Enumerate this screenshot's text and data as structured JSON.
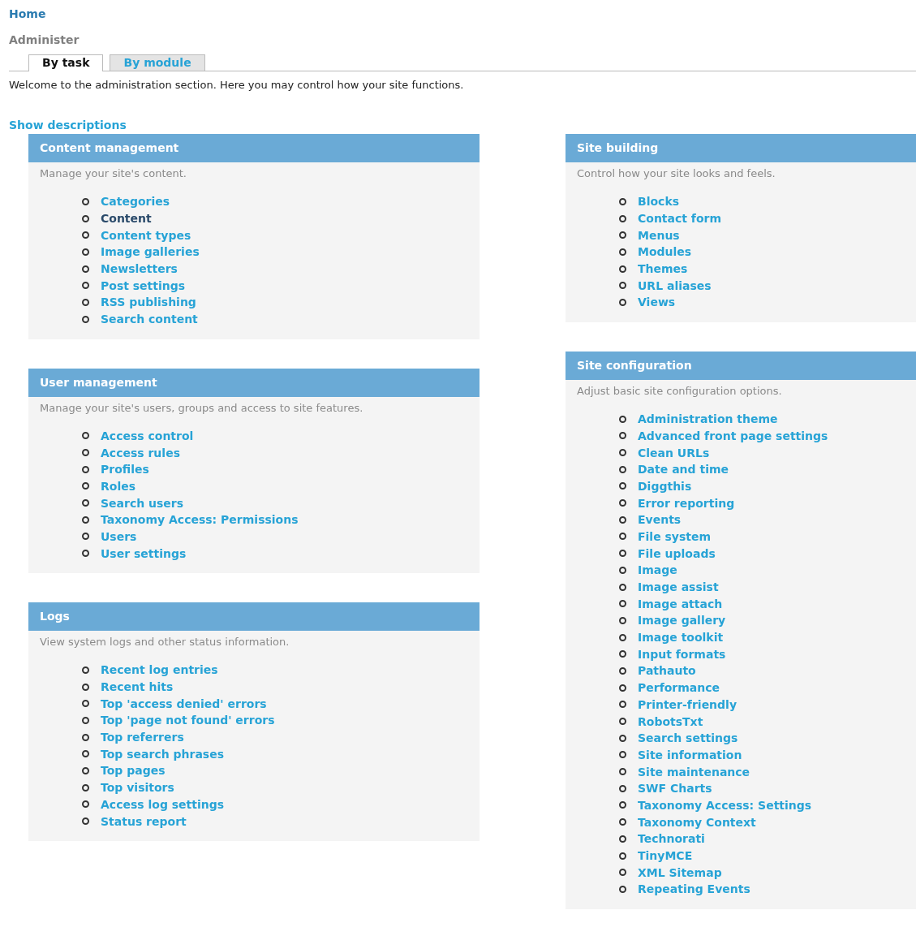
{
  "breadcrumb": "Home",
  "title": "Administer",
  "tabs": [
    {
      "label": "By task",
      "selected": true
    },
    {
      "label": "By module",
      "selected": false
    }
  ],
  "intro": "Welcome to the administration section. Here you may control how your site functions.",
  "toggle_link": "Show descriptions",
  "columns": [
    [
      {
        "title": "Content management",
        "description": "Manage your site's content.",
        "items": [
          {
            "label": "Categories",
            "visited": false
          },
          {
            "label": "Content",
            "visited": true
          },
          {
            "label": "Content types",
            "visited": false
          },
          {
            "label": "Image galleries",
            "visited": false
          },
          {
            "label": "Newsletters",
            "visited": false
          },
          {
            "label": "Post settings",
            "visited": false
          },
          {
            "label": "RSS publishing",
            "visited": false
          },
          {
            "label": "Search content",
            "visited": false
          }
        ]
      },
      {
        "title": "User management",
        "description": "Manage your site's users, groups and access to site features.",
        "items": [
          {
            "label": "Access control",
            "visited": false
          },
          {
            "label": "Access rules",
            "visited": false
          },
          {
            "label": "Profiles",
            "visited": false
          },
          {
            "label": "Roles",
            "visited": false
          },
          {
            "label": "Search users",
            "visited": false
          },
          {
            "label": "Taxonomy Access: Permissions",
            "visited": false
          },
          {
            "label": "Users",
            "visited": false
          },
          {
            "label": "User settings",
            "visited": false
          }
        ]
      },
      {
        "title": "Logs",
        "description": "View system logs and other status information.",
        "items": [
          {
            "label": "Recent log entries",
            "visited": false
          },
          {
            "label": "Recent hits",
            "visited": false
          },
          {
            "label": "Top 'access denied' errors",
            "visited": false
          },
          {
            "label": "Top 'page not found' errors",
            "visited": false
          },
          {
            "label": "Top referrers",
            "visited": false
          },
          {
            "label": "Top search phrases",
            "visited": false
          },
          {
            "label": "Top pages",
            "visited": false
          },
          {
            "label": "Top visitors",
            "visited": false
          },
          {
            "label": "Access log settings",
            "visited": false
          },
          {
            "label": "Status report",
            "visited": false
          }
        ]
      }
    ],
    [
      {
        "title": "Site building",
        "description": "Control how your site looks and feels.",
        "items": [
          {
            "label": "Blocks",
            "visited": false
          },
          {
            "label": "Contact form",
            "visited": false
          },
          {
            "label": "Menus",
            "visited": false
          },
          {
            "label": "Modules",
            "visited": false
          },
          {
            "label": "Themes",
            "visited": false
          },
          {
            "label": "URL aliases",
            "visited": false
          },
          {
            "label": "Views",
            "visited": false
          }
        ]
      },
      {
        "title": "Site configuration",
        "description": "Adjust basic site configuration options.",
        "items": [
          {
            "label": "Administration theme",
            "visited": false
          },
          {
            "label": "Advanced front page settings",
            "visited": false
          },
          {
            "label": "Clean URLs",
            "visited": false
          },
          {
            "label": "Date and time",
            "visited": false
          },
          {
            "label": "Diggthis",
            "visited": false
          },
          {
            "label": "Error reporting",
            "visited": false
          },
          {
            "label": "Events",
            "visited": false
          },
          {
            "label": "File system",
            "visited": false
          },
          {
            "label": "File uploads",
            "visited": false
          },
          {
            "label": "Image",
            "visited": false
          },
          {
            "label": "Image assist",
            "visited": false
          },
          {
            "label": "Image attach",
            "visited": false
          },
          {
            "label": "Image gallery",
            "visited": false
          },
          {
            "label": "Image toolkit",
            "visited": false
          },
          {
            "label": "Input formats",
            "visited": false
          },
          {
            "label": "Pathauto",
            "visited": false
          },
          {
            "label": "Performance",
            "visited": false
          },
          {
            "label": "Printer-friendly",
            "visited": false
          },
          {
            "label": "RobotsTxt",
            "visited": false
          },
          {
            "label": "Search settings",
            "visited": false
          },
          {
            "label": "Site information",
            "visited": false
          },
          {
            "label": "Site maintenance",
            "visited": false
          },
          {
            "label": "SWF Charts",
            "visited": false
          },
          {
            "label": "Taxonomy Access: Settings",
            "visited": false
          },
          {
            "label": "Taxonomy Context",
            "visited": false
          },
          {
            "label": "Technorati",
            "visited": false
          },
          {
            "label": "TinyMCE",
            "visited": false
          },
          {
            "label": "XML Sitemap",
            "visited": false
          },
          {
            "label": "Repeating Events",
            "visited": false
          }
        ]
      }
    ]
  ]
}
